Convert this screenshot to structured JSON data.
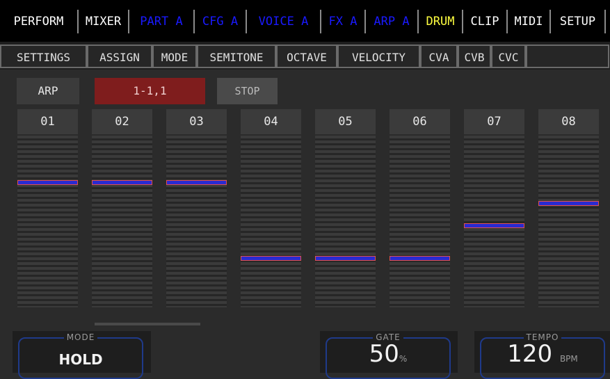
{
  "top_tabs": [
    {
      "label": "PERFORM",
      "color": "#ffffff"
    },
    {
      "label": "MIXER",
      "color": "#ffffff"
    },
    {
      "label": "PART A",
      "color": "#1a1aff"
    },
    {
      "label": "CFG A",
      "color": "#1a1aff"
    },
    {
      "label": "VOICE A",
      "color": "#1a1aff"
    },
    {
      "label": "FX A",
      "color": "#1a1aff"
    },
    {
      "label": "ARP A",
      "color": "#1a1aff"
    },
    {
      "label": "DRUM",
      "color": "#ffff40"
    },
    {
      "label": "CLIP",
      "color": "#ffffff"
    },
    {
      "label": "MIDI",
      "color": "#ffffff"
    },
    {
      "label": "SETUP",
      "color": "#ffffff"
    }
  ],
  "sub_tabs": [
    "SETTINGS",
    "ASSIGN",
    "MODE",
    "SEMITONE",
    "OCTAVE",
    "VELOCITY",
    "CVA",
    "CVB",
    "CVC"
  ],
  "controls": {
    "arp_label": "ARP",
    "position": "1-1,1",
    "stop_label": "STOP"
  },
  "steps": [
    {
      "label": "01",
      "level": 0.74
    },
    {
      "label": "02",
      "level": 0.74
    },
    {
      "label": "03",
      "level": 0.74
    },
    {
      "label": "04",
      "level": 0.3
    },
    {
      "label": "05",
      "level": 0.3
    },
    {
      "label": "06",
      "level": 0.3
    },
    {
      "label": "07",
      "level": 0.49
    },
    {
      "label": "08",
      "level": 0.62
    }
  ],
  "mode": {
    "title": "MODE",
    "value": "HOLD"
  },
  "gate": {
    "title": "GATE",
    "value": "50",
    "unit": "%"
  },
  "tempo": {
    "title": "TEMPO",
    "value": "120",
    "unit": "BPM"
  },
  "colors": {
    "accent_blue": "#1a1aff",
    "drum_yellow": "#ffff40",
    "marker_blue": "#2a2ad0",
    "marker_red": "#e05050",
    "position_red": "#7f1d1d"
  }
}
